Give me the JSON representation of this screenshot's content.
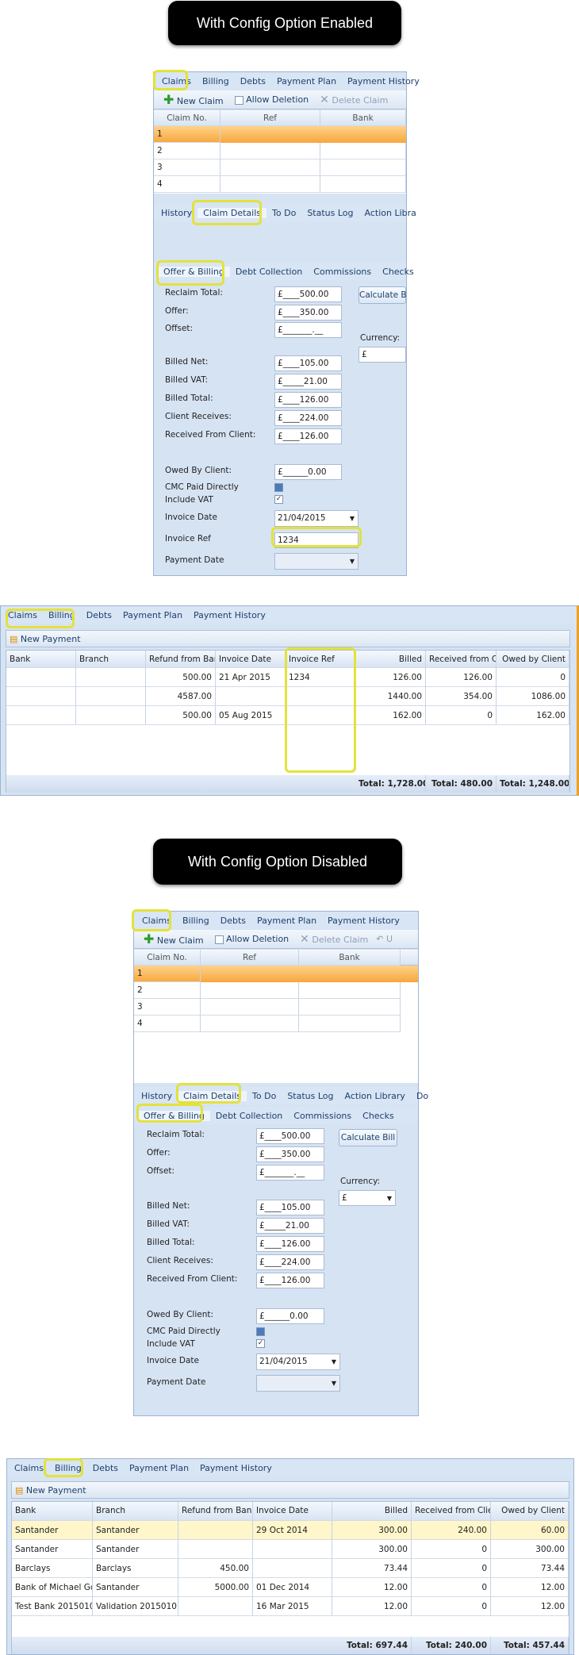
{
  "section1": {
    "banner": "With Config Option Enabled",
    "claims_tabs": [
      "Claims",
      "Billing",
      "Debts",
      "Payment Plan",
      "Payment History"
    ],
    "toolbar": {
      "new_claim": "New Claim",
      "allow_deletion": "Allow Deletion",
      "delete_claim": "Delete Claim"
    },
    "grid_headers": [
      "Claim No.",
      "Ref",
      "Bank"
    ],
    "rows": [
      "1",
      "2",
      "3",
      "4"
    ],
    "detail_tabs": [
      "History",
      "Claim Details",
      "To Do",
      "Status Log",
      "Action Libra"
    ],
    "sub_tabs": [
      "Offer & Billing",
      "Debt Collection",
      "Commissions",
      "Checks"
    ],
    "form": {
      "reclaim_total_label": "Reclaim Total:",
      "reclaim_total": "£____500.00",
      "offer_label": "Offer:",
      "offer": "£____350.00",
      "offset_label": "Offset:",
      "offset": "£_______.__",
      "billed_net_label": "Billed Net:",
      "billed_net": "£____105.00",
      "billed_vat_label": "Billed VAT:",
      "billed_vat": "£_____21.00",
      "billed_total_label": "Billed Total:",
      "billed_total": "£____126.00",
      "client_receives_label": "Client Receives:",
      "client_receives": "£____224.00",
      "received_from_client_label": "Received From Client:",
      "received_from_client": "£____126.00",
      "owed_by_client_label": "Owed By Client:",
      "owed_by_client": "£______0.00",
      "cmc_paid_label": "CMC Paid Directly",
      "include_vat_label": "Include VAT",
      "invoice_date_label": "Invoice Date",
      "invoice_date": "21/04/2015",
      "invoice_ref_label": "Invoice Ref",
      "invoice_ref": "1234",
      "payment_date_label": "Payment Date",
      "calculate_label": "Calculate B",
      "currency_label": "Currency:",
      "currency": "£"
    },
    "billing": {
      "tabs": [
        "Claims",
        "Billing",
        "Debts",
        "Payment Plan",
        "Payment History"
      ],
      "new_payment": "New Payment",
      "headers": [
        "Bank",
        "Branch",
        "Refund from Ban",
        "Invoice Date",
        "Invoice Ref",
        "Billed",
        "Received from C",
        "Owed by Client"
      ],
      "rows": [
        [
          "",
          "",
          "500.00",
          "21 Apr 2015",
          "1234",
          "126.00",
          "126.00",
          "0"
        ],
        [
          "",
          "",
          "4587.00",
          "",
          "",
          "1440.00",
          "354.00",
          "1086.00"
        ],
        [
          "",
          "",
          "500.00",
          "05 Aug 2015",
          "",
          "162.00",
          "0",
          "162.00"
        ]
      ],
      "totals": [
        "Total: 1,728.00",
        "Total: 480.00",
        "Total: 1,248.00"
      ]
    }
  },
  "section2": {
    "banner": "With Config Option Disabled",
    "claims_tabs": [
      "Claims",
      "Billing",
      "Debts",
      "Payment Plan",
      "Payment History"
    ],
    "toolbar": {
      "new_claim": "New Claim",
      "allow_deletion": "Allow Deletion",
      "delete_claim": "Delete Claim",
      "undo": "U"
    },
    "grid_headers": [
      "Claim No.",
      "Ref",
      "Bank"
    ],
    "rows": [
      "1",
      "2",
      "3",
      "4"
    ],
    "detail_tabs": [
      "History",
      "Claim Details",
      "To Do",
      "Status Log",
      "Action Library",
      "Do"
    ],
    "sub_tabs": [
      "Offer & Billing",
      "Debt Collection",
      "Commissions",
      "Checks"
    ],
    "form": {
      "reclaim_total_label": "Reclaim Total:",
      "reclaim_total": "£____500.00",
      "offer_label": "Offer:",
      "offer": "£____350.00",
      "offset_label": "Offset:",
      "offset": "£_______.__",
      "billed_net_label": "Billed Net:",
      "billed_net": "£____105.00",
      "billed_vat_label": "Billed VAT:",
      "billed_vat": "£_____21.00",
      "billed_total_label": "Billed Total:",
      "billed_total": "£____126.00",
      "client_receives_label": "Client Receives:",
      "client_receives": "£____224.00",
      "received_from_client_label": "Received From Client:",
      "received_from_client": "£____126.00",
      "owed_by_client_label": "Owed By Client:",
      "owed_by_client": "£______0.00",
      "cmc_paid_label": "CMC Paid Directly",
      "include_vat_label": "Include VAT",
      "invoice_date_label": "Invoice Date",
      "invoice_date": "21/04/2015",
      "payment_date_label": "Payment Date",
      "calculate_label": "Calculate Bill",
      "currency_label": "Currency:",
      "currency": "£"
    },
    "billing": {
      "tabs": [
        "Claims",
        "Billing",
        "Debts",
        "Payment Plan",
        "Payment History"
      ],
      "new_payment": "New Payment",
      "headers": [
        "Bank",
        "Branch",
        "Refund from Bank",
        "Invoice Date",
        "Billed",
        "Received from Clier",
        "Owed by Client"
      ],
      "rows": [
        [
          "Santander",
          "Santander",
          "",
          "29 Oct 2014",
          "300.00",
          "240.00",
          "60.00"
        ],
        [
          "Santander",
          "Santander",
          "",
          "",
          "300.00",
          "0",
          "300.00"
        ],
        [
          "Barclays",
          "Barclays",
          "450.00",
          "",
          "73.44",
          "0",
          "73.44"
        ],
        [
          "Bank of Michael Gc",
          "Santander",
          "5000.00",
          "01 Dec 2014",
          "12.00",
          "0",
          "12.00"
        ],
        [
          "Test Bank 2015010",
          "Validation 2015010",
          "",
          "16 Mar 2015",
          "12.00",
          "0",
          "12.00"
        ]
      ],
      "totals": [
        "Total: 697.44",
        "Total: 240.00",
        "Total: 457.44"
      ]
    }
  }
}
